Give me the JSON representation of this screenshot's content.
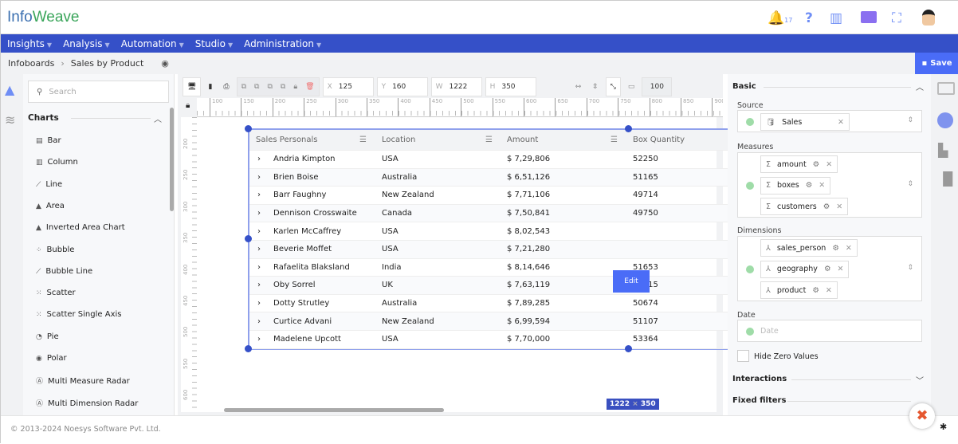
{
  "header": {
    "logo": "InfoWeave",
    "notifications": "17",
    "brand_color": "#3550c8",
    "accent_color": "#4a6cf7"
  },
  "nav": [
    "Insights",
    "Analysis",
    "Automation",
    "Studio",
    "Administration"
  ],
  "breadcrumb": {
    "root": "Infoboards",
    "current": "Sales by Product",
    "save": "Save"
  },
  "left": {
    "search_placeholder": "Search",
    "section": "Charts",
    "items": [
      {
        "icon": "bar-chart-icon",
        "label": "Bar"
      },
      {
        "icon": "column-chart-icon",
        "label": "Column"
      },
      {
        "icon": "line-chart-icon",
        "label": "Line"
      },
      {
        "icon": "area-chart-icon",
        "label": "Area"
      },
      {
        "icon": "inverted-area-icon",
        "label": "Inverted Area Chart"
      },
      {
        "icon": "bubble-icon",
        "label": "Bubble"
      },
      {
        "icon": "bubble-line-icon",
        "label": "Bubble Line"
      },
      {
        "icon": "scatter-icon",
        "label": "Scatter"
      },
      {
        "icon": "scatter-single-icon",
        "label": "Scatter Single Axis"
      },
      {
        "icon": "pie-icon",
        "label": "Pie"
      },
      {
        "icon": "polar-icon",
        "label": "Polar"
      },
      {
        "icon": "radar-icon",
        "label": "Multi Measure Radar"
      },
      {
        "icon": "radar-icon",
        "label": "Multi Dimension Radar"
      }
    ]
  },
  "toolbar": {
    "x_label": "X",
    "x": "125",
    "y_label": "Y",
    "y": "160",
    "w_label": "W",
    "w": "1222",
    "h_label": "H",
    "h": "350",
    "zoom": "100"
  },
  "ruler": {
    "h": [
      "100",
      "150",
      "200",
      "250",
      "300",
      "350",
      "400",
      "450",
      "500",
      "550",
      "600",
      "650",
      "700",
      "750",
      "800",
      "850",
      "900"
    ],
    "v": [
      "200",
      "250",
      "300",
      "350",
      "400",
      "450",
      "500",
      "550",
      "600"
    ]
  },
  "table": {
    "columns": [
      "Sales Personals",
      "Location",
      "Amount",
      "Box Quantity"
    ],
    "rows": [
      [
        "Andria Kimpton",
        "USA",
        "$ 7,29,806",
        "52250"
      ],
      [
        "Brien Boise",
        "Australia",
        "$ 6,51,126",
        "51165"
      ],
      [
        "Barr Faughny",
        "New Zealand",
        "$ 7,71,106",
        "49714"
      ],
      [
        "Dennison Crosswaite",
        "Canada",
        "$ 7,50,841",
        "49750"
      ],
      [
        "Karlen McCaffrey",
        "USA",
        "$ 8,02,543",
        ""
      ],
      [
        "Beverie Moffet",
        "USA",
        "$ 7,21,280",
        ""
      ],
      [
        "Rafaelita Blaksland",
        "India",
        "$ 8,14,646",
        "51653"
      ],
      [
        "Oby Sorrel",
        "UK",
        "$ 7,63,119",
        "51315"
      ],
      [
        "Dotty Strutley",
        "Australia",
        "$ 7,89,285",
        "50674"
      ],
      [
        "Curtice Advani",
        "New Zealand",
        "$ 6,99,594",
        "51107"
      ],
      [
        "Madelene Upcott",
        "USA",
        "$ 7,70,000",
        "53364"
      ]
    ],
    "edit": "Edit",
    "dims_w": "1222",
    "dims_x": "×",
    "dims_h": "350"
  },
  "right": {
    "basic": "Basic",
    "source_label": "Source",
    "source": "Sales",
    "measures_label": "Measures",
    "measures": [
      "amount",
      "boxes",
      "customers"
    ],
    "dimensions_label": "Dimensions",
    "dimensions": [
      "sales_person",
      "geography",
      "product"
    ],
    "date_label": "Date",
    "date_placeholder": "Date",
    "hide_zero": "Hide Zero Values",
    "interactions": "Interactions",
    "fixed_filters": "Fixed filters"
  },
  "footer": "© 2013-2024 Noesys Software Pvt. Ltd."
}
